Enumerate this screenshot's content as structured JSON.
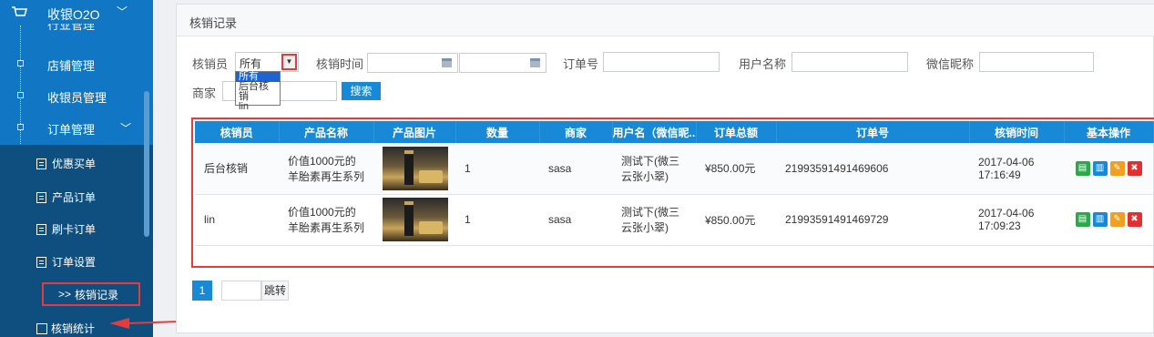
{
  "sidebar": {
    "title": "收银O2O",
    "cut_item": "行业管理",
    "items": [
      {
        "label": "店铺管理"
      },
      {
        "label": "收银员管理"
      },
      {
        "label": "订单管理"
      }
    ],
    "sub_items": [
      {
        "label": "优惠买单"
      },
      {
        "label": "产品订单"
      },
      {
        "label": "刷卡订单"
      },
      {
        "label": "订单设置"
      }
    ],
    "active_item": {
      "prefix": ">>",
      "label": "核销记录"
    },
    "stat_item": {
      "label": "核销统计"
    }
  },
  "panel": {
    "title": "核销记录"
  },
  "filters": {
    "verifier_label": "核销员",
    "verifier_value": "所有",
    "verifier_options": [
      "所有",
      "后台核销",
      "lin"
    ],
    "time_label": "核销时间",
    "time_sep": "-",
    "order_label": "订单号",
    "user_label": "用户名称",
    "wechat_label": "微信昵称",
    "merchant_label": "商家",
    "search_button": "搜索"
  },
  "table": {
    "headers": [
      "核销员",
      "产品名称",
      "产品图片",
      "数量",
      "商家",
      "用户名（微信昵...",
      "订单总额",
      "订单号",
      "核销时间",
      "基本操作"
    ],
    "rows": [
      {
        "verifier": "后台核销",
        "product": "价值1000元的羊胎素再生系列",
        "qty": "1",
        "merchant": "sasa",
        "user": "测试下(微三云张小翠)",
        "amount": "¥850.00元",
        "order_no": "21993591491469606",
        "time_date": "2017-04-06",
        "time_clock": "17:16:49"
      },
      {
        "verifier": "lin",
        "product": "价值1000元的羊胎素再生系列",
        "qty": "1",
        "merchant": "sasa",
        "user": "测试下(微三云张小翠)",
        "amount": "¥850.00元",
        "order_no": "21993591491469729",
        "time_date": "2017-04-06",
        "time_clock": "17:09:23"
      }
    ],
    "op_icons": [
      {
        "name": "detail-icon",
        "color": "#2aa84a"
      },
      {
        "name": "edit-icon",
        "color": "#1789d6"
      },
      {
        "name": "pencil-icon",
        "color": "#f0a020"
      },
      {
        "name": "delete-icon",
        "color": "#e03030"
      }
    ]
  },
  "pagination": {
    "current": "1",
    "jump_label": "跳转"
  },
  "colors": {
    "sidebar_bg": "#1177c4",
    "submenu_bg": "#0e4f7f",
    "header_blue": "#1789d6",
    "highlight_red": "#e63b3b"
  }
}
